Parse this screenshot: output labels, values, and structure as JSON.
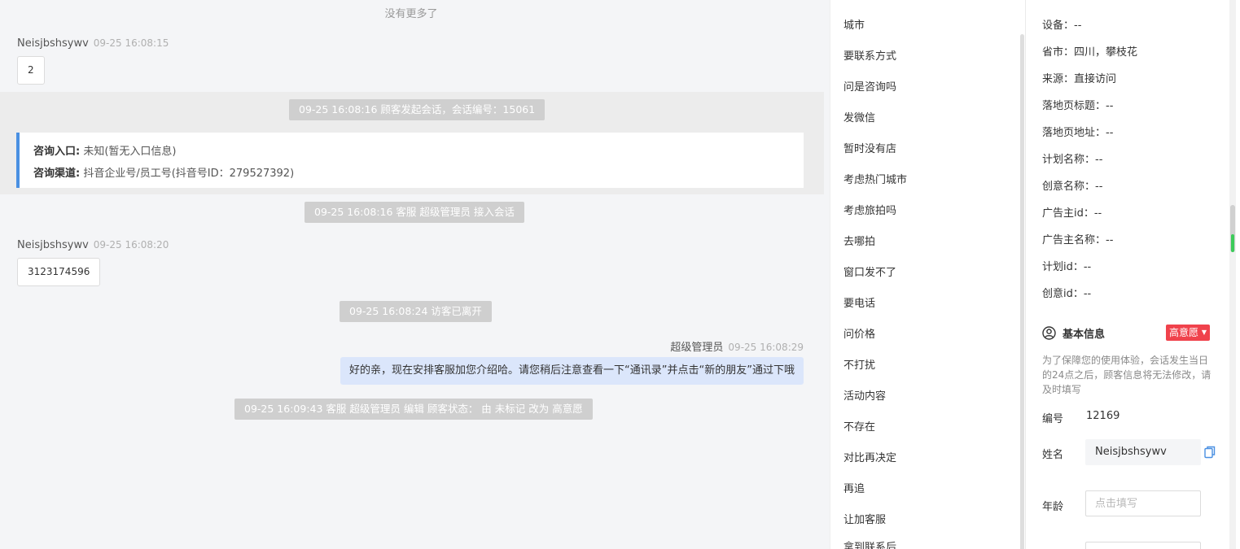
{
  "chat": {
    "no_more": "没有更多了",
    "messages": [
      {
        "sender": "Neisjbshsywv",
        "time": "09-25 16:08:15",
        "text": "2"
      },
      {
        "sender": "Neisjbshsywv",
        "time": "09-25 16:08:20",
        "text": "3123174596"
      }
    ],
    "system": [
      "09-25 16:08:16 顾客发起会话，会话编号：15061",
      "09-25 16:08:16 客服 超级管理员 接入会话",
      "09-25 16:08:24 访客已离开",
      "09-25 16:09:43 客服 超级管理员 编辑 顾客状态： 由 未标记 改为 高意愿"
    ],
    "consult": {
      "entry_label": "咨询入口:",
      "entry_value": "未知(暂无入口信息)",
      "channel_label": "咨询渠道:",
      "channel_value": "抖音企业号/员工号(抖音号ID：279527392)"
    },
    "agent_message": {
      "sender": "超级管理员",
      "time": "09-25 16:08:29",
      "text": "好的亲，现在安排客服加您介绍哈。请您稍后注意查看一下“通讯录”并点击“新的朋友”通过下哦"
    }
  },
  "quick_replies": [
    "城市",
    "要联系方式",
    "问是咨询吗",
    "发微信",
    "暂时没有店",
    "考虑热门城市",
    "考虑旅拍吗",
    "去哪拍",
    "窗口发不了",
    "要电话",
    "问价格",
    "不打扰",
    "活动内容",
    "不存在",
    "对比再决定",
    "再追",
    "让加客服",
    "拿到联系后"
  ],
  "customer": {
    "attributes": [
      {
        "label": "设备",
        "value": "--"
      },
      {
        "label": "省市",
        "value": "四川，攀枝花"
      },
      {
        "label": "来源",
        "value": "直接访问"
      },
      {
        "label": "落地页标题",
        "value": "--"
      },
      {
        "label": "落地页地址",
        "value": "--"
      },
      {
        "label": "计划名称",
        "value": "--"
      },
      {
        "label": "创意名称",
        "value": "--"
      },
      {
        "label": "广告主id",
        "value": "--"
      },
      {
        "label": "广告主名称",
        "value": "--"
      },
      {
        "label": "计划id",
        "value": "--"
      },
      {
        "label": "创意id",
        "value": "--"
      }
    ],
    "attr_lines": [
      "设备：--",
      "省市：四川，攀枝花",
      "来源：直接访问",
      "落地页标题：--",
      "落地页地址：--",
      "计划名称：--",
      "创意名称：--",
      "广告主id：--",
      "广告主名称：--",
      "计划id：--",
      "创意id：--"
    ],
    "basic_title": "基本信息",
    "intent_badge": "高意愿",
    "notice": "为了保障您的使用体验，会话发生当日的24点之后，顾客信息将无法修改，请及时填写",
    "id_label": "编号",
    "id_value": "12169",
    "name_label": "姓名",
    "name_value": "Neisjbshsywv",
    "age_label": "年龄",
    "age_placeholder": "点击填写"
  },
  "colors": {
    "accent_blue": "#4a90e2",
    "badge_red": "#f0424c",
    "agent_bubble": "#dbe6fb",
    "system_gray": "#cfcfcf"
  }
}
